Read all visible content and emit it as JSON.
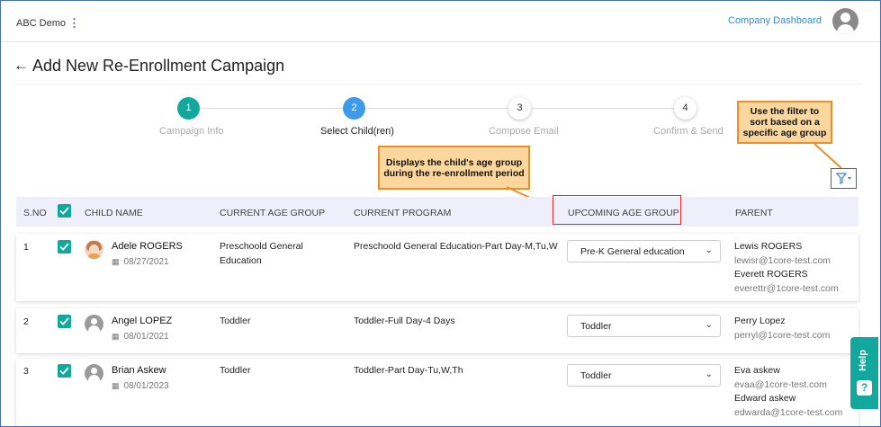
{
  "header": {
    "brand": "ABC Demo",
    "menu_icon": "vertical-dots-icon",
    "company_link": "Company Dashboard",
    "avatar_icon": "user-avatar-icon"
  },
  "page": {
    "back_icon": "arrow-left-icon",
    "title": "Add New Re-Enrollment Campaign"
  },
  "stepper": {
    "steps": [
      {
        "number": "1",
        "label": "Campaign Info",
        "state": "completed"
      },
      {
        "number": "2",
        "label": "Select Child(ren)",
        "state": "active"
      },
      {
        "number": "3",
        "label": "Compose Email",
        "state": "pending"
      },
      {
        "number": "4",
        "label": "Confirm & Send",
        "state": "pending"
      }
    ],
    "colors": {
      "completed": "#13a89e",
      "active": "#3d9be9"
    }
  },
  "callouts": {
    "age_group": "Displays the child's age group during the re-enrollment period",
    "filter": "Use the filter to sort based on a specific age group"
  },
  "filter": {
    "icon": "filter-icon"
  },
  "table": {
    "headers": {
      "sno": "S.NO",
      "child_name": "CHILD NAME",
      "current_age_group": "CURRENT AGE GROUP",
      "current_program": "CURRENT PROGRAM",
      "upcoming_age_group": "UPCOMING AGE GROUP",
      "parent": "PARENT"
    },
    "rows": [
      {
        "sno": "1",
        "checked": true,
        "name": "Adele ROGERS",
        "dob": "08/27/2021",
        "current_age_group_line1": "Preschoold General",
        "current_age_group_line2": "Education",
        "current_program": "Preschoold General Education-Part Day-M,Tu,W",
        "upcoming_age_group": "Pre-K General education",
        "parent1_name": "Lewis ROGERS",
        "parent1_email": "lewisr@1core-test.com",
        "parent2_name": "Everett ROGERS",
        "parent2_email": "everettr@1core-test.com"
      },
      {
        "sno": "2",
        "checked": true,
        "name": "Angel LOPEZ",
        "dob": "08/01/2021",
        "current_age_group": "Toddler",
        "current_program": "Toddler-Full Day-4 Days",
        "upcoming_age_group": "Toddler",
        "parent1_name": "Perry Lopez",
        "parent1_email": "perryl@1core-test.com"
      },
      {
        "sno": "3",
        "checked": true,
        "name": "Brian Askew",
        "dob": "08/01/2023",
        "current_age_group": "Toddler",
        "current_program": "Toddler-Part Day-Tu,W,Th",
        "upcoming_age_group": "Toddler",
        "parent1_name": "Eva askew",
        "parent1_email": "evaa@1core-test.com",
        "parent2_name": "Edward askew",
        "parent2_email": "edwarda@1core-test.com"
      }
    ]
  },
  "help": {
    "label": "Help",
    "icon": "question-icon"
  },
  "colors": {
    "accent_teal": "#13a89e",
    "accent_blue": "#3d9be9",
    "link_blue": "#2a8fd6",
    "highlight_red": "#e02828",
    "callout_fill": "#fbd79d",
    "callout_border": "#f08c2c"
  }
}
